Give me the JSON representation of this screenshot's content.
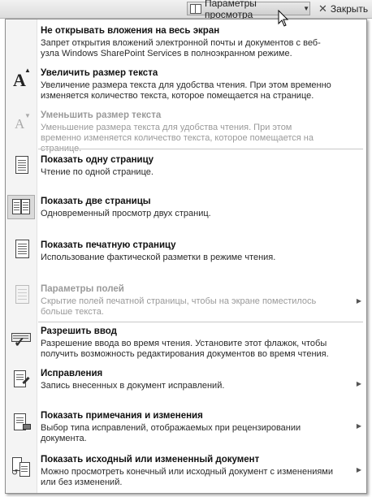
{
  "toolbar": {
    "view_options_label": "Параметры просмотра",
    "close_label": "Закрыть"
  },
  "menu": {
    "items": [
      {
        "title": "Не открывать вложения на весь экран",
        "desc": "Запрет открытия вложений электронной почты и документов с веб-узла Windows SharePoint Services в полноэкранном режиме."
      },
      {
        "title": "Увеличить размер текста",
        "desc": "Увеличение размера текста для удобства чтения. При этом временно изменяется количество текста, которое помещается на странице."
      },
      {
        "title": "Уменьшить размер текста",
        "desc": "Уменьшение размера текста для удобства чтения. При этом временно изменяется количество текста, которое помещается на странице."
      },
      {
        "title": "Показать одну страницу",
        "desc": "Чтение по одной странице."
      },
      {
        "title": "Показать две страницы",
        "desc": "Одновременный просмотр двух страниц."
      },
      {
        "title": "Показать печатную страницу",
        "desc": "Использование фактической разметки в режиме чтения."
      },
      {
        "title": "Параметры полей",
        "desc": "Скрытие полей печатной страницы, чтобы на экране поместилось больше текста."
      },
      {
        "title": "Разрешить ввод",
        "desc": "Разрешение ввода во время чтения. Установите этот флажок, чтобы получить возможность редактирования документов во время чтения."
      },
      {
        "title": "Исправления",
        "desc": "Запись внесенных в документ исправлений."
      },
      {
        "title": "Показать примечания и изменения",
        "desc": "Выбор типа исправлений, отображаемых при рецензировании документа."
      },
      {
        "title": "Показать исходный или измененный документ",
        "desc": "Можно просмотреть конечный или исходный документ с изменениями или без изменений."
      }
    ]
  }
}
